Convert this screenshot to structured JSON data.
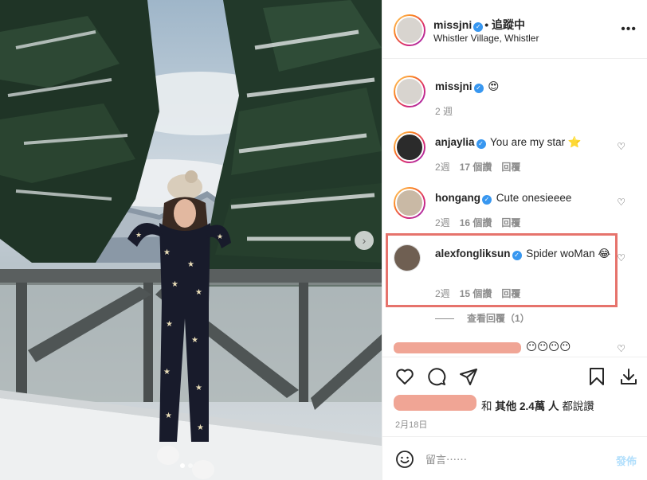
{
  "post": {
    "owner": "missjni",
    "follow_status": "• 追蹤中",
    "location": "Whistler Village, Whistler",
    "more_icon": "more-horizontal-icon"
  },
  "caption": {
    "username": "missjni",
    "text": "😍",
    "time": "2 週"
  },
  "comments": [
    {
      "username": "anjaylia",
      "text": "You are my star ⭐",
      "time": "2週",
      "likes": "17 個讚",
      "reply": "回覆"
    },
    {
      "username": "hongang",
      "text": "Cute onesieeee",
      "time": "2週",
      "likes": "16 個讚",
      "reply": "回覆"
    },
    {
      "username": "alexfongliksun",
      "text": "Spider woMan 😂",
      "time": "2週",
      "likes": "15 個讚",
      "reply": "回覆"
    }
  ],
  "view_replies": "查看回覆（1）",
  "partial_comment_emoji": "😶😶😶😶",
  "likes_summary": {
    "and": "和",
    "others": "其他 2.4萬 人",
    "suffix": "都說讚"
  },
  "date": "2月18日",
  "compose": {
    "placeholder": "留言⋯⋯",
    "post_label": "發佈"
  },
  "colors": {
    "verified": "#3897f0",
    "highlight_box": "#e6736c",
    "redaction": "#f0a595"
  }
}
